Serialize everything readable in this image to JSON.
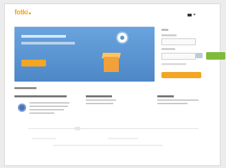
{
  "header": {
    "logo_text": "fotki",
    "language_icon": "flag-icon"
  },
  "colors": {
    "brand": "#f1a51d",
    "banner": "#5a95d2",
    "cta": "#f3a524",
    "accent_green": "#7fba3a"
  },
  "icons": {
    "banner_top": "gear-icon",
    "banner_art": "box-icon",
    "feature": "badge-icon"
  }
}
